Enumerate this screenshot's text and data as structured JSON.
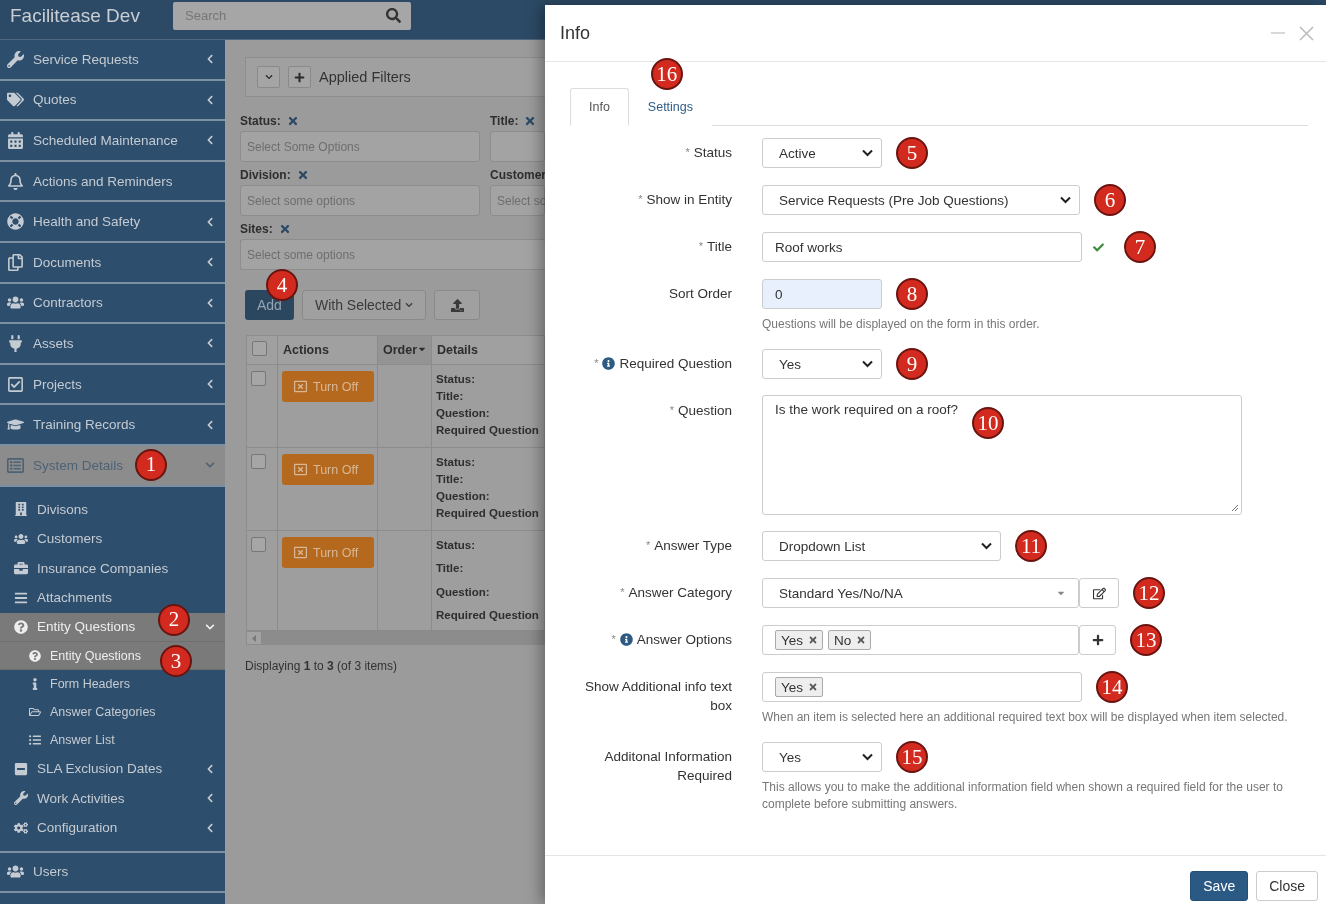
{
  "topbar": {
    "brand": "Facilitease Dev",
    "search": {
      "placeholder": "Search"
    }
  },
  "sidebar": {
    "items": [
      {
        "label": "Service Requests",
        "selected": false,
        "expandable": true,
        "expanded": false
      },
      {
        "label": "Quotes",
        "selected": false,
        "expandable": true,
        "expanded": false
      },
      {
        "label": "Scheduled Maintenance",
        "selected": false,
        "expandable": true,
        "expanded": false
      },
      {
        "label": "Actions and Reminders",
        "selected": false,
        "expandable": false
      },
      {
        "label": "Health and Safety",
        "selected": false,
        "expandable": true,
        "expanded": false
      },
      {
        "label": "Documents",
        "selected": false,
        "expandable": true,
        "expanded": false
      },
      {
        "label": "Contractors",
        "selected": false,
        "expandable": true,
        "expanded": false
      },
      {
        "label": "Assets",
        "selected": false,
        "expandable": true,
        "expanded": false
      },
      {
        "label": "Projects",
        "selected": false,
        "expandable": true,
        "expanded": false
      },
      {
        "label": "Training Records",
        "selected": false,
        "expandable": true,
        "expanded": false
      },
      {
        "label": "System Details",
        "selected": true,
        "expandable": true,
        "expanded": true,
        "badge": "1",
        "children": [
          {
            "label": "Divisons",
            "selected": false,
            "expandable": false
          },
          {
            "label": "Customers",
            "selected": false,
            "expandable": false
          },
          {
            "label": "Insurance Companies",
            "selected": false,
            "expandable": false
          },
          {
            "label": "Attachments",
            "selected": false,
            "expandable": false
          },
          {
            "label": "Entity Questions",
            "selected": true,
            "expandable": true,
            "expanded": true,
            "badge": "2",
            "children": [
              {
                "label": "Entity Questions",
                "selected": true,
                "badge": "3"
              },
              {
                "label": "Form Headers",
                "selected": false
              },
              {
                "label": "Answer Categories",
                "selected": false
              },
              {
                "label": "Answer List",
                "selected": false
              }
            ]
          },
          {
            "label": "SLA Exclusion Dates",
            "selected": false,
            "expandable": true,
            "expanded": false
          },
          {
            "label": "Work Activities",
            "selected": false,
            "expandable": true,
            "expanded": false
          },
          {
            "label": "Configuration",
            "selected": false,
            "expandable": true,
            "expanded": false
          }
        ]
      },
      {
        "label": "Users",
        "selected": false,
        "expandable": false
      }
    ]
  },
  "filters": {
    "title": "Applied Filters",
    "fields": [
      {
        "label": "Status:",
        "removable": true,
        "placeholder": "Select Some Options"
      },
      {
        "label": "Title:",
        "removable": true
      },
      {
        "label": "Division:",
        "removable": true,
        "placeholder": "Select some options"
      },
      {
        "label": "Customer",
        "placeholder": "Select so"
      },
      {
        "label": "Sites:",
        "removable": true,
        "placeholder": "Select some options"
      }
    ]
  },
  "toolbar": {
    "add": {
      "label": "Add",
      "badge": "4"
    },
    "with_selected": "With Selected"
  },
  "table": {
    "all_checked": false,
    "columns": [
      {
        "label": "Actions",
        "sorted": false
      },
      {
        "label": "Order",
        "sorted": true
      },
      {
        "label": "Details",
        "sorted": false
      }
    ],
    "rows": [
      {
        "checked": false,
        "action": "Turn Off",
        "details": [
          "Status:",
          "Title:",
          "Question:",
          "Required Question"
        ]
      },
      {
        "checked": false,
        "action": "Turn Off",
        "details": [
          "Status:",
          "Title:",
          "Question:",
          "Required Question"
        ]
      },
      {
        "checked": false,
        "action": "Turn Off",
        "details": [
          "Status:",
          "Title:",
          "Question:",
          "Required Question"
        ]
      }
    ]
  },
  "pager": "Displaying **1** to **3** (of 3 items)",
  "modal": {
    "title": "Info",
    "tabs": [
      {
        "label": "Info",
        "selected": true
      },
      {
        "label": "Settings",
        "selected": false,
        "badge": "16"
      }
    ],
    "fields": [
      {
        "kind": "select",
        "required_mark": "*",
        "label": "Status",
        "value": "Active",
        "badge": "5"
      },
      {
        "kind": "select",
        "required_mark": "*",
        "label": "Show in Entity",
        "value": "Service Requests (Pre Job Questions)",
        "badge": "6"
      },
      {
        "kind": "text",
        "required_mark": "*",
        "label": "Title",
        "value": "Roof works",
        "valid": true,
        "badge": "7"
      },
      {
        "kind": "number",
        "label": "Sort Order",
        "value": "0",
        "highlighted": true,
        "badge": "8",
        "help": "Questions will be displayed on the form in this order."
      },
      {
        "kind": "select",
        "required_mark": "*",
        "info": true,
        "label": "Required Question",
        "value": "Yes",
        "badge": "9"
      },
      {
        "kind": "textarea",
        "required_mark": "*",
        "label": "Question",
        "value": "Is the work required on a roof?",
        "badge": "10"
      },
      {
        "kind": "select",
        "required_mark": "*",
        "label": "Answer Type",
        "value": "Dropdown List",
        "badge": "11"
      },
      {
        "kind": "combo",
        "required_mark": "*",
        "label": "Answer Category",
        "value": "Standard Yes/No/NA",
        "badge": "12"
      },
      {
        "kind": "tags",
        "required_mark": "*",
        "info": true,
        "label": "Answer Options",
        "tags": [
          "Yes",
          "No"
        ],
        "addable": true,
        "badge": "13"
      },
      {
        "kind": "tags",
        "label": "Show Additional info text box",
        "tags": [
          "Yes"
        ],
        "addable": false,
        "badge": "14",
        "help": "When an item is selected here an additional required text box will be displayed when item selected."
      },
      {
        "kind": "select",
        "label": "Additonal Information Required",
        "value": "Yes",
        "badge": "15",
        "help": "This allows you to make the additional information field when shown a required field for the user to complete before submitting answers."
      }
    ],
    "buttons": [
      {
        "label": "Save",
        "kind": "primary"
      },
      {
        "label": "Close",
        "kind": "default"
      }
    ]
  }
}
